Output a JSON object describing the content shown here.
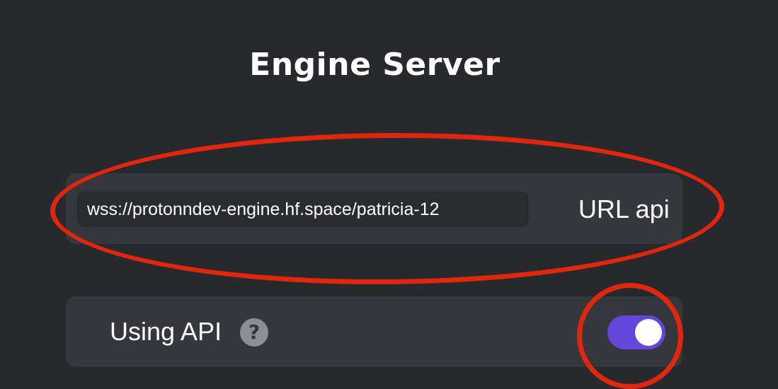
{
  "header": {
    "title": "Engine Server"
  },
  "engine_url": {
    "value": "wss://protonndev-engine.hf.space/patricia-12",
    "label": "URL api"
  },
  "api_toggle": {
    "label": "Using API",
    "help_glyph": "?",
    "help_icon": "question-circle-icon",
    "state": "on",
    "accent_color": "#6346db"
  },
  "annotations": {
    "color": "#e0260c"
  },
  "colors": {
    "background": "#28292d",
    "row_background": "#36373c",
    "input_background": "#2a2b2f"
  }
}
